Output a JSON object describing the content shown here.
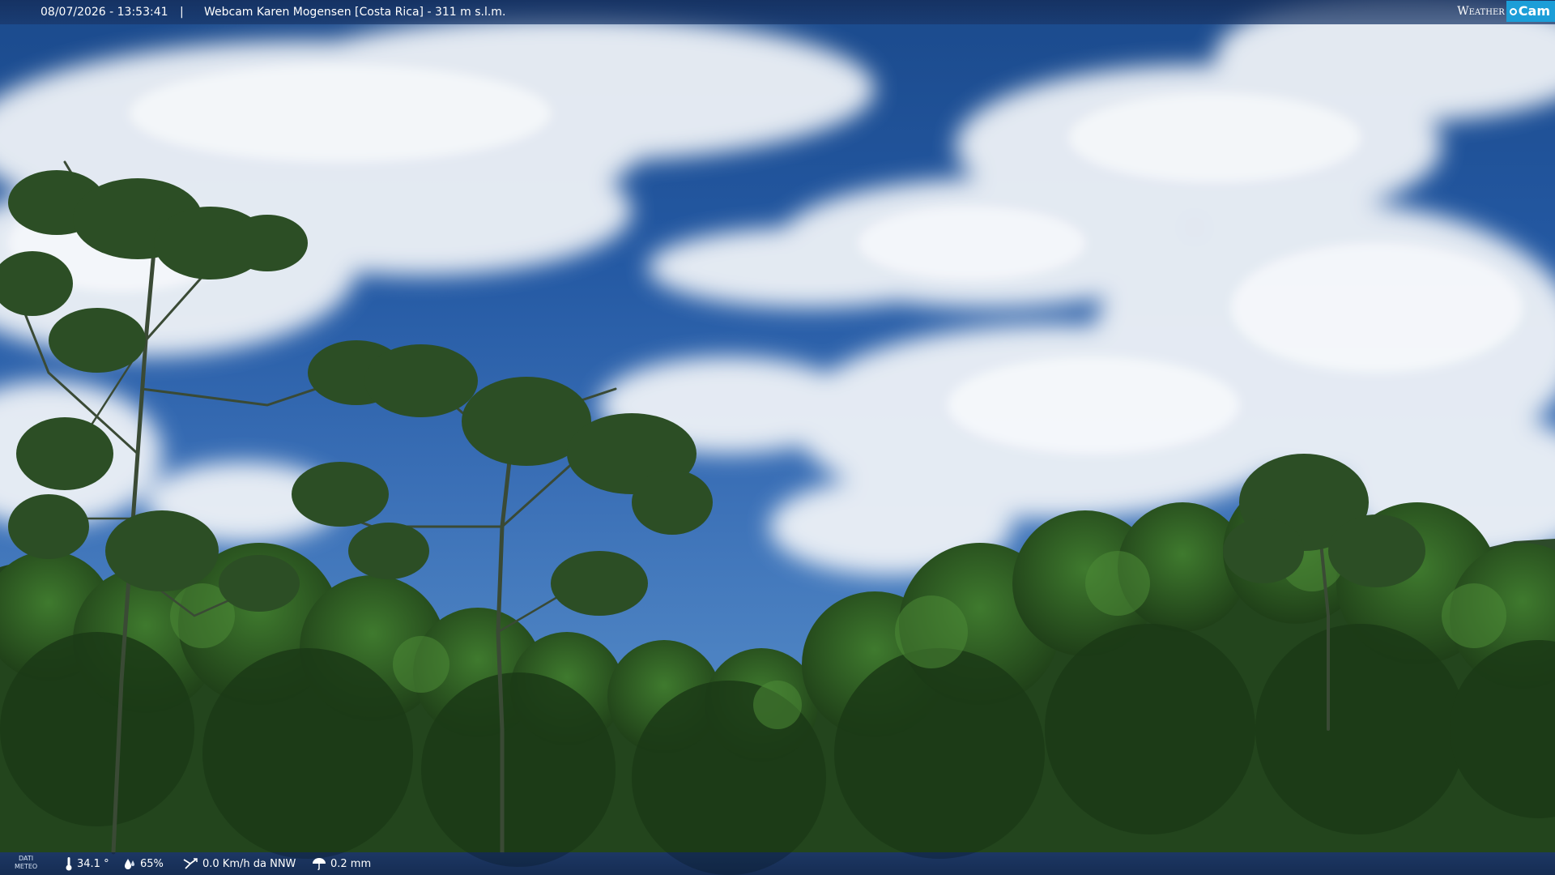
{
  "overlay": {
    "timestamp": "08/07/2026 - 13:53:41",
    "separator": "|",
    "title": "Webcam Karen Mogensen [Costa Rica] - 311 m s.l.m."
  },
  "logo": {
    "weather": "Weather",
    "cam": "Cam"
  },
  "weather_bar": {
    "label_line1": "DATI",
    "label_line2": "METEO",
    "temperature": "34.1 °",
    "humidity": "65%",
    "wind": "0.0 Km/h da NNW",
    "rain": "0.2 mm",
    "icons": [
      "thermometer-icon",
      "humidity-icon",
      "wind-icon",
      "rain-icon"
    ]
  },
  "colors": {
    "sky": "#2459a3",
    "cloud": "#f1f4f8",
    "foliage": "#2c5a22",
    "bar": "#142c5a",
    "logo_accent": "#1c9ed8"
  }
}
